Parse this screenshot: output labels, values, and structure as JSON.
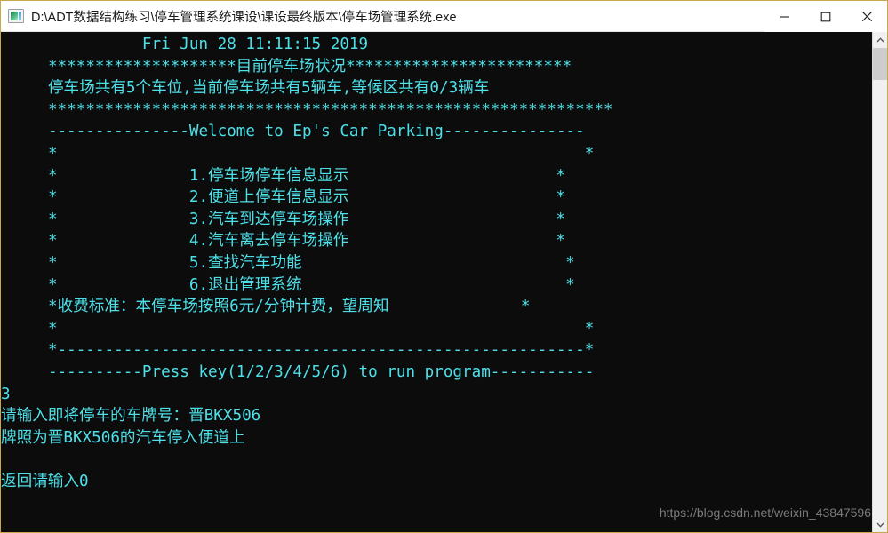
{
  "window": {
    "title": "D:\\ADT数据结构练习\\停车管理系统课设\\课设最终版本\\停车场管理系统.exe",
    "icon": "console-app-icon",
    "border_color": "#c8a84b",
    "controls": {
      "minimize_label": "—",
      "maximize_label": "□",
      "close_label": "✕"
    }
  },
  "console": {
    "background_color": "#0c0c0c",
    "text_color": "#4de0e8",
    "lines": [
      "               Fri Jun 28 11:11:15 2019",
      "     ********************目前停车场状况************************",
      "     停车场共有5个车位,当前停车场共有5辆车,等候区共有0/3辆车",
      "     ************************************************************",
      "     ---------------Welcome to Ep's Car Parking---------------",
      "     *                                                        *",
      "     *              1.停车场停车信息显示                      *",
      "     *              2.便道上停车信息显示                      *",
      "     *              3.汽车到达停车场操作                      *",
      "     *              4.汽车离去停车场操作                      *",
      "     *              5.查找汽车功能                            *",
      "     *              6.退出管理系统                            *",
      "     *收费标准：本停车场按照6元/分钟计费，望周知              *",
      "     *                                                        *",
      "     *--------------------------------------------------------*",
      "     ----------Press key(1/2/3/4/5/6) to run program-----------",
      "3",
      "请输入即将停车的车牌号：晋BKX506",
      "牌照为晋BKX506的汽车停入便道上",
      "",
      "返回请输入0"
    ],
    "date_time": "Fri Jun 28 11:11:15 2019",
    "status_title": "目前停车场状况",
    "status_line": "停车场共有5个车位,当前停车场共有5辆车,等候区共有0/3辆车",
    "total_spaces": 5,
    "cars_parked": 5,
    "waiting_current": 0,
    "waiting_capacity": 3,
    "banner": "Welcome to Ep's Car Parking",
    "menu_items": [
      "1.停车场停车信息显示",
      "2.便道上停车信息显示",
      "3.汽车到达停车场操作",
      "4.汽车离去停车场操作",
      "5.查找汽车功能",
      "6.退出管理系统"
    ],
    "fee_notice": "收费标准：本停车场按照6元/分钟计费，望周知",
    "prompt": "Press key(1/2/3/4/5/6) to run program",
    "user_choice": "3",
    "plate_prompt": "请输入即将停车的车牌号：",
    "plate_entered": "晋BKX506",
    "result_message": "牌照为晋BKX506的汽车停入便道上",
    "return_prompt": "返回请输入0"
  },
  "scrollbar": {
    "up_arrow": "⌃",
    "down_arrow": "⌄",
    "thumb_position_percent": 3
  },
  "watermark": {
    "text": "https://blog.csdn.net/weixin_43847596"
  }
}
